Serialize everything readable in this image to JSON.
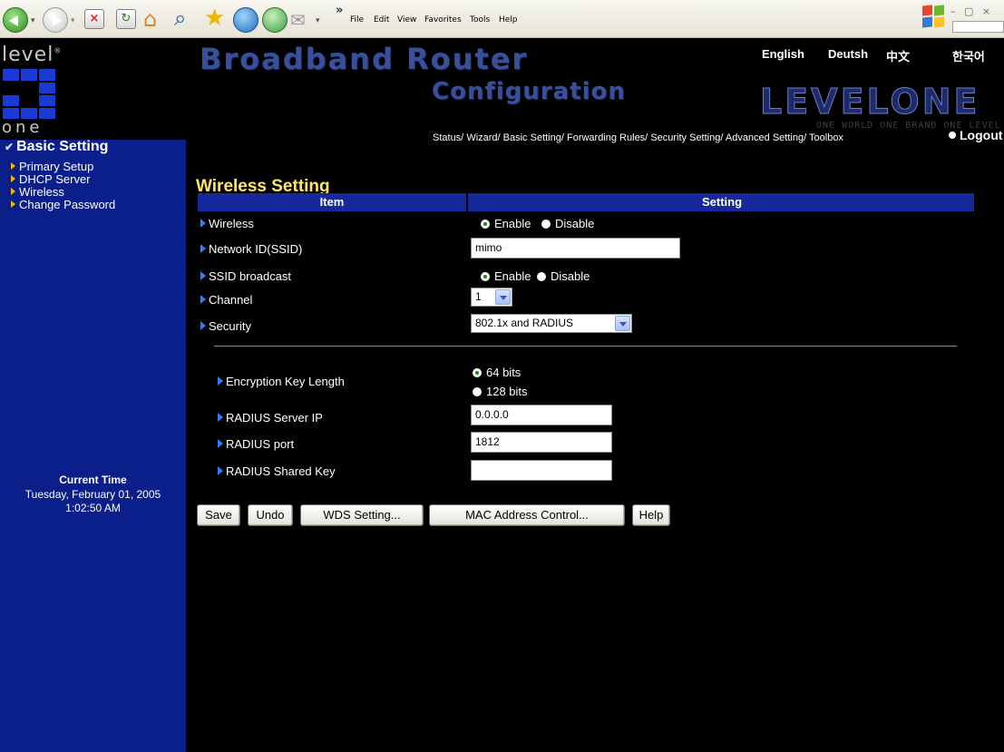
{
  "browser": {
    "menu": [
      "File",
      "Edit",
      "View",
      "Favorites",
      "Tools",
      "Help"
    ],
    "overflow": "»",
    "window_controls": "– ▢ ×"
  },
  "sidebar": {
    "logo_top": "level",
    "logo_mark": "®",
    "logo_bottom": "one",
    "section_title": "Basic Setting",
    "items": [
      {
        "label": "Primary Setup"
      },
      {
        "label": "DHCP Server"
      },
      {
        "label": "Wireless"
      },
      {
        "label": "Change Password"
      }
    ],
    "time_label": "Current Time",
    "time_date": "Tuesday, February 01, 2005",
    "time_clock": "1:02:50 AM"
  },
  "header": {
    "brand_line1": "Broadband Router",
    "brand_line2": "Configuration",
    "languages": [
      "English",
      "Deutsh",
      "中文",
      "한국어"
    ],
    "brand_logo": "LEVELONE",
    "tagline": "ONE WORLD ONE BRAND ONE LEVEL",
    "nav": [
      "Status/",
      "Wizard/",
      "Basic Setting/",
      "Forwarding Rules/",
      "Security Setting/",
      "Advanced Setting/",
      "Toolbox"
    ],
    "logout": "Logout"
  },
  "main": {
    "title": "Wireless Setting",
    "col_item": "Item",
    "col_setting": "Setting",
    "rows": {
      "wireless": {
        "label": "Wireless",
        "opt1": "Enable",
        "opt2": "Disable",
        "selected": "Enable"
      },
      "ssid": {
        "label": "Network ID(SSID)",
        "value": "mimo"
      },
      "broadcast": {
        "label": "SSID broadcast",
        "opt1": "Enable",
        "opt2": "Disable",
        "selected": "Enable"
      },
      "channel": {
        "label": "Channel",
        "value": "1"
      },
      "security": {
        "label": "Security",
        "value": "802.1x and RADIUS"
      }
    },
    "radius": {
      "key_length": {
        "label": "Encryption Key Length",
        "opt1": "64 bits",
        "opt2": "128 bits",
        "selected": "64 bits"
      },
      "server_ip": {
        "label": "RADIUS Server IP",
        "value": "0.0.0.0"
      },
      "port": {
        "label": "RADIUS port",
        "value": "1812"
      },
      "shared_key": {
        "label": "RADIUS Shared Key",
        "value": ""
      }
    },
    "buttons": {
      "save": "Save",
      "undo": "Undo",
      "wds": "WDS Setting...",
      "mac": "MAC Address Control...",
      "help": "Help"
    }
  },
  "colors": {
    "sidebar_bg": "#0a1f8a",
    "table_header": "#16289a",
    "title": "#ffe56a",
    "nav_arrow": "#f5b800",
    "row_arrow": "#2f7bff"
  }
}
